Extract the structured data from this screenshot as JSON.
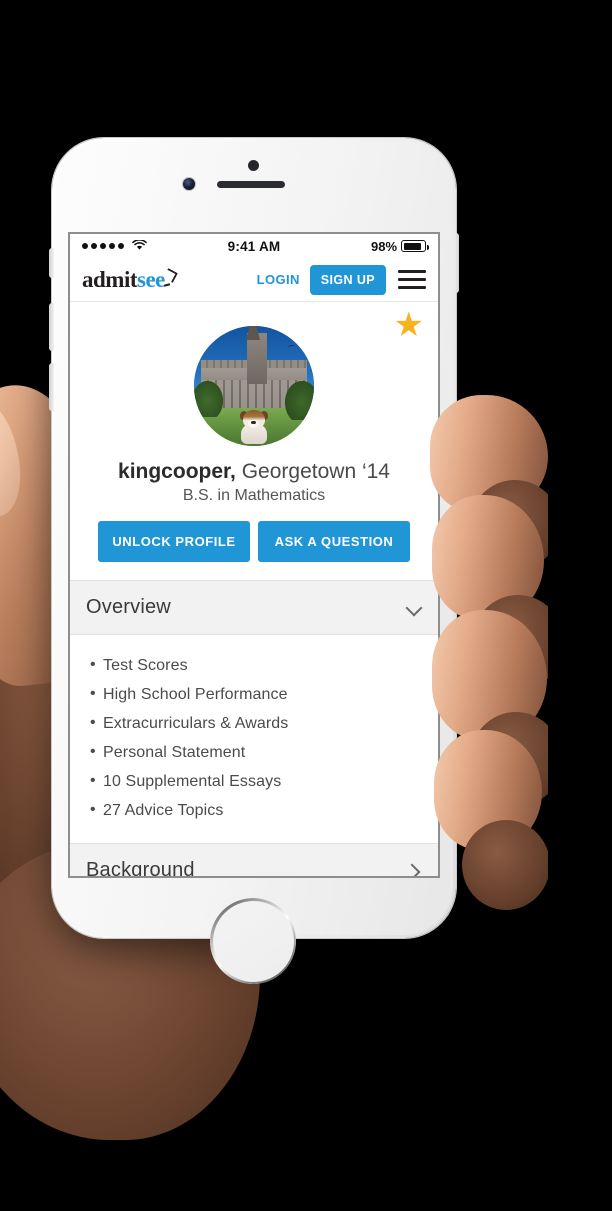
{
  "device": {
    "name": "white-smartphone",
    "held_by": "hand"
  },
  "statusbar": {
    "signal_dots": 5,
    "wifi_icon": "wifi-icon",
    "time": "9:41 AM",
    "battery_percent": "98%",
    "battery_icon": "battery-icon"
  },
  "navbar": {
    "logo_part1": "admit",
    "logo_part2": "see",
    "logo_mark": "check-mark-icon",
    "login_label": "LOGIN",
    "signup_label": "SIGN UP",
    "menu_icon": "hamburger-menu-icon"
  },
  "profile": {
    "featured_star_icon": "star-icon",
    "star_color": "#f9b321",
    "avatar_name": "avatar-campus-bulldog",
    "username": "kingcooper,",
    "school": "Georgetown ‘14",
    "degree": "B.S. in Mathematics",
    "unlock_label": "UNLOCK PROFILE",
    "ask_label": "ASK A QUESTION",
    "accent_color": "#2196d6"
  },
  "sections": [
    {
      "title": "Overview",
      "expanded": true,
      "chevron": "chevron-down-icon",
      "items": [
        "Test Scores",
        "High School Performance",
        "Extracurriculars & Awards",
        "Personal Statement",
        "10 Supplemental Essays",
        "27 Advice Topics"
      ]
    },
    {
      "title": "Background",
      "expanded": false,
      "chevron": "chevron-right-icon",
      "items": []
    }
  ]
}
